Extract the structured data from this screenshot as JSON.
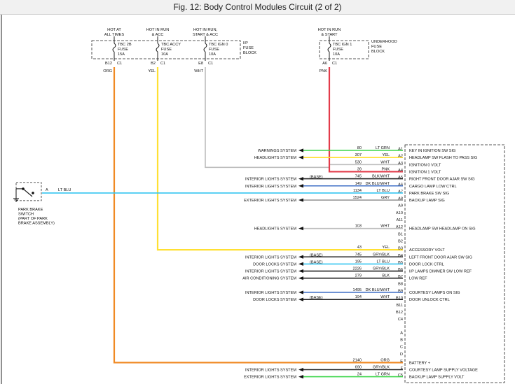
{
  "title": "Fig. 12: Body Control Modules Circuit (2 of 2)",
  "colors": {
    "org": "#f08a24",
    "yel": "#ffe033",
    "wht": "#bdbdbd",
    "pnk": "#e33b4a",
    "ltgrn": "#3cd64a",
    "dkblu": "#3f6fc6",
    "ltblu": "#35c6f0",
    "blk": "#222222",
    "gry": "#9a9a9a"
  },
  "fuses": [
    {
      "header": [
        "HOT AT",
        "ALL TIMES"
      ],
      "labels": [
        "TBC 2B",
        "FUSE",
        "15A"
      ],
      "pin": "B12",
      "conn": "C1",
      "color_label": "ORG",
      "wire": "org"
    },
    {
      "header": [
        "HOT IN RUN",
        "& ACC"
      ],
      "labels": [
        "TBC ACCY",
        "FUSE",
        "10A"
      ],
      "pin": "B2",
      "conn": "C1",
      "color_label": "YEL",
      "wire": "yel"
    },
    {
      "header": [
        "HOT IN RUN,",
        "START & ACC"
      ],
      "labels": [
        "TBC IGN 0",
        "FUSE",
        "10A"
      ],
      "pin": "E8",
      "conn": "C1",
      "color_label": "WHT",
      "wire": "wht"
    },
    {
      "header": [
        "HOT IN RUN",
        "& START"
      ],
      "labels": [
        "TBC IGN 1",
        "FUSE",
        "10A"
      ],
      "pin": "A6",
      "conn": "C1",
      "color_label": "PNK",
      "wire": "pnk"
    }
  ],
  "block_labels": {
    "ip": [
      "I/P",
      "FUSE",
      "BLOCK"
    ],
    "underhood": [
      "UNDERHOOD",
      "FUSE",
      "BLOCK"
    ]
  },
  "switch": {
    "pin": "A",
    "wire_label": "LT BLU",
    "labels": [
      "PARK BRAKE",
      "SWITCH",
      "(PART OF PARK",
      "BRAKE ASSEMBLY)"
    ]
  },
  "bcm_rows": [
    {
      "pin": "A1",
      "circuit": "80",
      "color": "LT GRN",
      "wire": "ltgrn",
      "system": "WARNINGS SYSTEM",
      "fn": "KEY IN IGNITION SW SIG"
    },
    {
      "pin": "A2",
      "circuit": "307",
      "color": "YEL",
      "wire": "yel",
      "system": "HEADLIGHTS SYSTEM",
      "fn": "HEADLAMP SW FLASH TO PASS SIG"
    },
    {
      "pin": "A3",
      "circuit": "530",
      "color": "WHT",
      "wire": "wht",
      "fn": "IGNITION 0 VOLT",
      "source": "wht"
    },
    {
      "pin": "A4",
      "circuit": "39",
      "color": "PNK",
      "wire": "pnk",
      "fn": "IGNITION 1 VOLT",
      "source": "pnk"
    },
    {
      "pin": "A5",
      "circuit": "745",
      "color": "BLK/WHT",
      "wire": "blk",
      "system": "INTERIOR LIGHTS SYSTEM",
      "base": "(BASE)",
      "fn": "RIGHT FRONT DOOR AJAR SW SIG"
    },
    {
      "pin": "A6",
      "circuit": "149",
      "color": "DK BLU/WHT",
      "wire": "dkblu",
      "system": "INTERIOR LIGHTS SYSTEM",
      "fn": "CARGO LAMP LOW CTRL"
    },
    {
      "pin": "A7",
      "circuit": "1134",
      "color": "LT BLU",
      "wire": "ltblu",
      "fn": "PARK BRAKE SW SIG",
      "source": "switch"
    },
    {
      "pin": "A8",
      "circuit": "1524",
      "color": "GRY",
      "wire": "gry",
      "system": "EXTERIOR LIGHTS SYSTEM",
      "fn": "BACKUP LAMP SIG"
    },
    {
      "pin": "A9"
    },
    {
      "pin": "A10"
    },
    {
      "pin": "A11"
    },
    {
      "pin": "A12",
      "circuit": "103",
      "color": "WHT",
      "wire": "wht",
      "system": "HEADLIGHTS SYSTEM",
      "fn": "HEADLAMP SW HEADLAMP ON SIG"
    },
    {
      "pin": "B1"
    },
    {
      "pin": "B2"
    },
    {
      "pin": "B3",
      "circuit": "43",
      "color": "YEL",
      "wire": "yel",
      "fn": "ACCESSORY VOLT",
      "source": "yel"
    },
    {
      "pin": "B4",
      "circuit": "745",
      "color": "GRY/BLK",
      "wire": "blk",
      "system": "INTERIOR LIGHTS SYSTEM",
      "base": "(BASE)",
      "fn": "LEFT FRONT DOOR AJAR SW SIG"
    },
    {
      "pin": "B5",
      "circuit": "195",
      "color": "LT BLU",
      "wire": "ltblu",
      "system": "DOOR LOCKS SYSTEM",
      "base": "(BASE)",
      "fn": "DOOR LOCK CTRL"
    },
    {
      "pin": "B6",
      "circuit": "2226",
      "color": "GRY/BLK",
      "wire": "blk",
      "system": "INTERIOR LIGHTS SYSTEM",
      "fn": "I/P LAMPS DIMMER SW LOW REF"
    },
    {
      "pin": "B7",
      "circuit": "279",
      "color": "BLK",
      "wire": "blk",
      "system": "AIR CONDITIONING SYSTEM",
      "fn": "LOW REF"
    },
    {
      "pin": "B8"
    },
    {
      "pin": "B9",
      "circuit": "1495",
      "color": "DK BLU/WHT",
      "wire": "dkblu",
      "system": "INTERIOR LIGHTS SYSTEM",
      "fn": "COURTESY LAMPS ON SIG"
    },
    {
      "pin": "B10",
      "circuit": "194",
      "color": "WHT",
      "wire": "blk",
      "system": "DOOR LOCKS SYSTEM",
      "base": "(BASE)",
      "fn": "DOOR UNLOCK CTRL"
    },
    {
      "pin": "B11"
    },
    {
      "pin": "B12"
    },
    {
      "pin": "C4"
    }
  ],
  "bcm_bottom_rows": [
    {
      "pin": "A"
    },
    {
      "pin": "B"
    },
    {
      "pin": "C"
    },
    {
      "pin": "D"
    },
    {
      "pin": "E",
      "circuit": "2140",
      "color": "ORG",
      "wire": "org",
      "fn": "BATTERY +",
      "source": "org"
    },
    {
      "pin": "F",
      "circuit": "690",
      "color": "GRY/BLK",
      "wire": "blk",
      "system": "INTERIOR LIGHTS SYSTEM",
      "fn": "COURTESY LAMP SUPPLY VOLTAGE"
    },
    {
      "pin": "C5",
      "circuit": "24",
      "color": "LT GRN",
      "wire": "ltgrn",
      "system": "EXTERIOR LIGHTS SYSTEM",
      "fn": "BACKUP LAMP SUPPLY VOLT"
    }
  ]
}
